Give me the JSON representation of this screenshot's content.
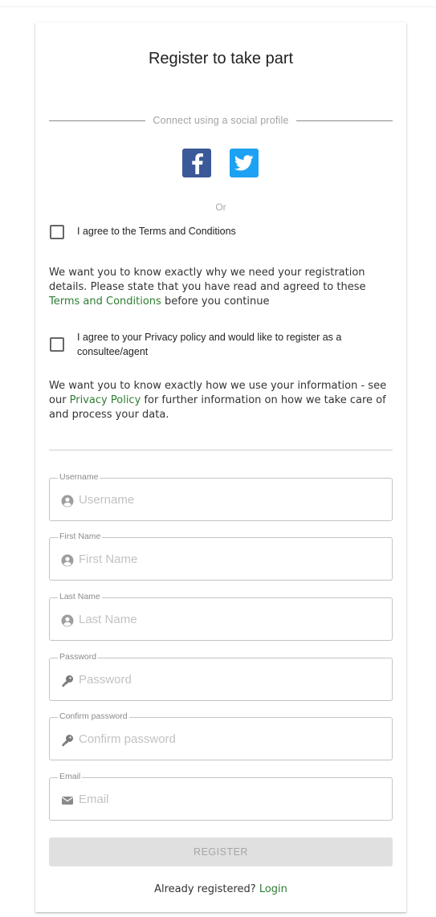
{
  "title": "Register to take part",
  "social": {
    "divider_text": "Connect using a social profile",
    "providers": [
      {
        "name": "facebook",
        "icon": "facebook-icon",
        "color": "#3b5998"
      },
      {
        "name": "twitter",
        "icon": "twitter-icon",
        "color": "#1da1f2"
      }
    ],
    "or_text": "Or"
  },
  "terms": {
    "checkbox_label": "I agree to the Terms and Conditions",
    "checked": false,
    "para_before": "We want you to know exactly why we need your registration details. Please state that you have read and agreed to these ",
    "link_text": "Terms and Conditions",
    "para_after": " before you continue"
  },
  "privacy": {
    "checkbox_label": "I agree to your Privacy policy and would like to register as a consultee/agent",
    "checked": false,
    "para_before": "We want you to know exactly how we use your information - see our ",
    "link_text": "Privacy Policy",
    "para_after": " for further information on how we take care of and process your data."
  },
  "fields": {
    "username": {
      "label": "Username",
      "placeholder": "Username",
      "value": "",
      "icon": "user-icon"
    },
    "first_name": {
      "label": "First Name",
      "placeholder": "First Name",
      "value": "",
      "icon": "user-icon"
    },
    "last_name": {
      "label": "Last Name",
      "placeholder": "Last Name",
      "value": "",
      "icon": "user-icon"
    },
    "password": {
      "label": "Password",
      "placeholder": "Password",
      "value": "",
      "icon": "key-icon"
    },
    "confirm_password": {
      "label": "Confirm password",
      "placeholder": "Confirm password",
      "value": "",
      "icon": "key-icon"
    },
    "email": {
      "label": "Email",
      "placeholder": "Email",
      "value": "",
      "icon": "envelope-icon"
    }
  },
  "register_button": "REGISTER",
  "login": {
    "prompt": "Already registered? ",
    "link_text": "Login"
  },
  "colors": {
    "link": "#2e7d32",
    "button_disabled": "#e0e0e0"
  }
}
